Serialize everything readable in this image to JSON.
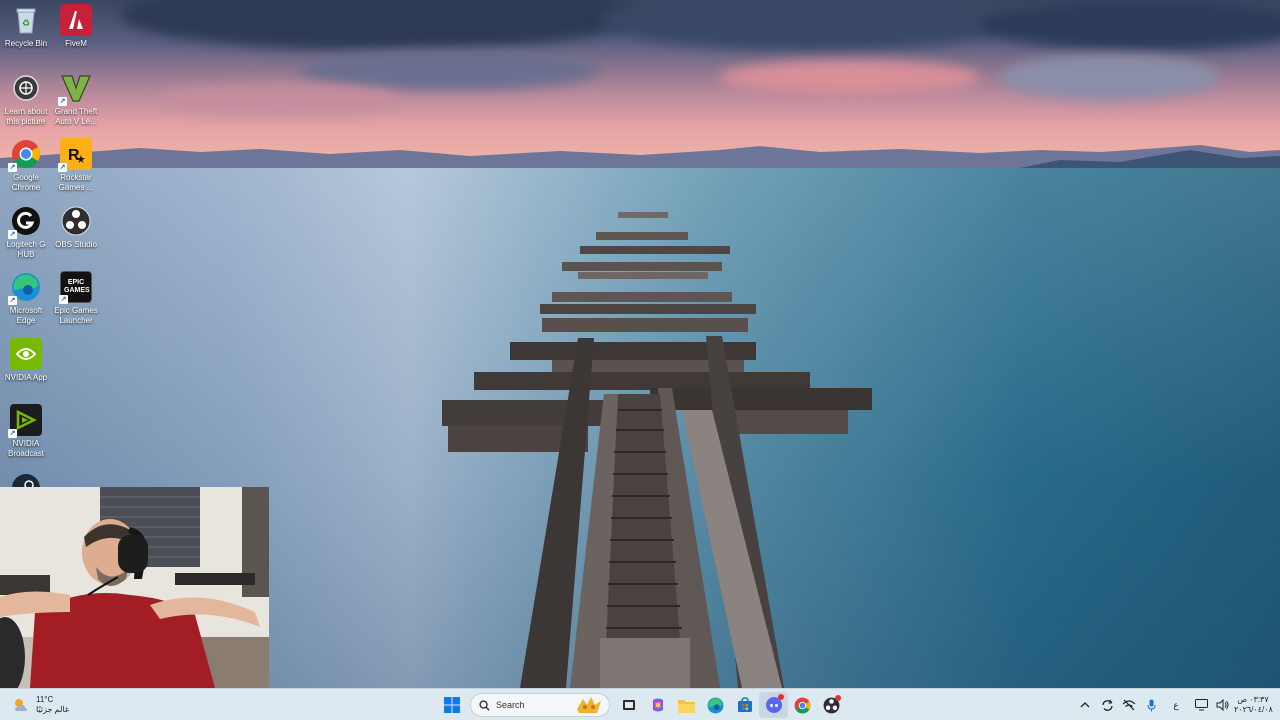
{
  "desktop": {
    "icons": [
      {
        "label": "Recycle Bin",
        "icon": "recycle-bin-icon"
      },
      {
        "label": "FiveM",
        "icon": "fivem-icon"
      },
      {
        "label": "Learn about this picture",
        "icon": "learn-about-picture-icon"
      },
      {
        "label": "Grand Theft Auto V Le...",
        "icon": "gta-v-icon"
      },
      {
        "label": "Google Chrome",
        "icon": "chrome-icon"
      },
      {
        "label": "Rockstar Games ...",
        "icon": "rockstar-games-icon"
      },
      {
        "label": "Logitech G HUB",
        "icon": "logitech-g-hub-icon"
      },
      {
        "label": "OBS Studio",
        "icon": "obs-studio-icon"
      },
      {
        "label": "Microsoft Edge",
        "icon": "edge-icon"
      },
      {
        "label": "Epic Games Launcher",
        "icon": "epic-games-icon"
      },
      {
        "label": "NVIDIA App",
        "icon": "nvidia-app-icon"
      },
      {
        "label": "NVIDIA Broadcast",
        "icon": "nvidia-broadcast-icon"
      }
    ],
    "epic_icon_text": "EPIC GAMES"
  },
  "taskbar": {
    "weather_temp": "11°C",
    "weather_desc": "غالم جزئيًا",
    "search_label": "Search",
    "language": "ع",
    "time": "٠٣:٣٧ ص",
    "date": "٢٠٢٦/٠٤/٠٨"
  },
  "colors": {
    "taskbar_bg": "#dde9f1",
    "accent_blue": "#1a6bd0",
    "fivem_red": "#c9203a",
    "nvidia_green": "#76b900"
  }
}
